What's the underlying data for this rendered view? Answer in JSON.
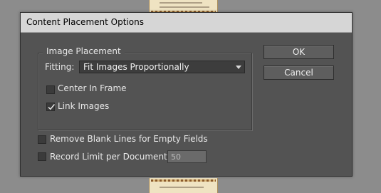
{
  "dialog": {
    "title": "Content Placement Options"
  },
  "image_placement": {
    "group_label": "Image Placement",
    "fitting_label": "Fitting:",
    "fitting_selected": "Fit Images Proportionally",
    "center_in_frame": {
      "label": "Center In Frame",
      "checked": false
    },
    "link_images": {
      "label": "Link Images",
      "checked": true
    }
  },
  "options": {
    "remove_blank_lines": {
      "label": "Remove Blank Lines for Empty Fields",
      "checked": false
    },
    "record_limit": {
      "label": "Record Limit per Document:",
      "checked": false,
      "value": "50"
    }
  },
  "buttons": {
    "ok": "OK",
    "cancel": "Cancel"
  },
  "icons": {
    "dropdown": "chevron-down-icon",
    "check": "checkmark-icon"
  },
  "colors": {
    "dialog_bg": "#535353",
    "title_bar_bg": "#d6d6d6",
    "text": "#e8e8e8"
  }
}
